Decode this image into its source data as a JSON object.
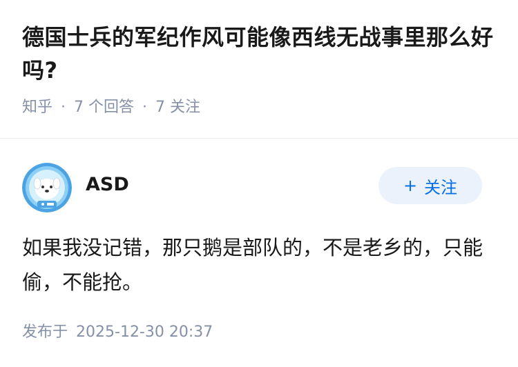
{
  "question": {
    "title": "德国士兵的军纪作风可能像西线无战事里那么好吗?",
    "source": "知乎",
    "answers_count": "7 个回答",
    "followers_count": "7 关注"
  },
  "answer": {
    "author": {
      "name": "ASD",
      "avatar": "avatar-dog-astronaut-icon"
    },
    "follow_button": {
      "icon": "plus-icon",
      "plus_symbol": "+",
      "label": "关注"
    },
    "content": "如果我没记错，那只鹅是部队的，不是老乡的，只能偷，不能抢。",
    "publish_label": "发布于",
    "publish_time": "2025-12-30 20:37"
  },
  "colors": {
    "accent": "#056de8",
    "follow_bg": "#ebf2fb",
    "meta_text": "#8590a6"
  }
}
